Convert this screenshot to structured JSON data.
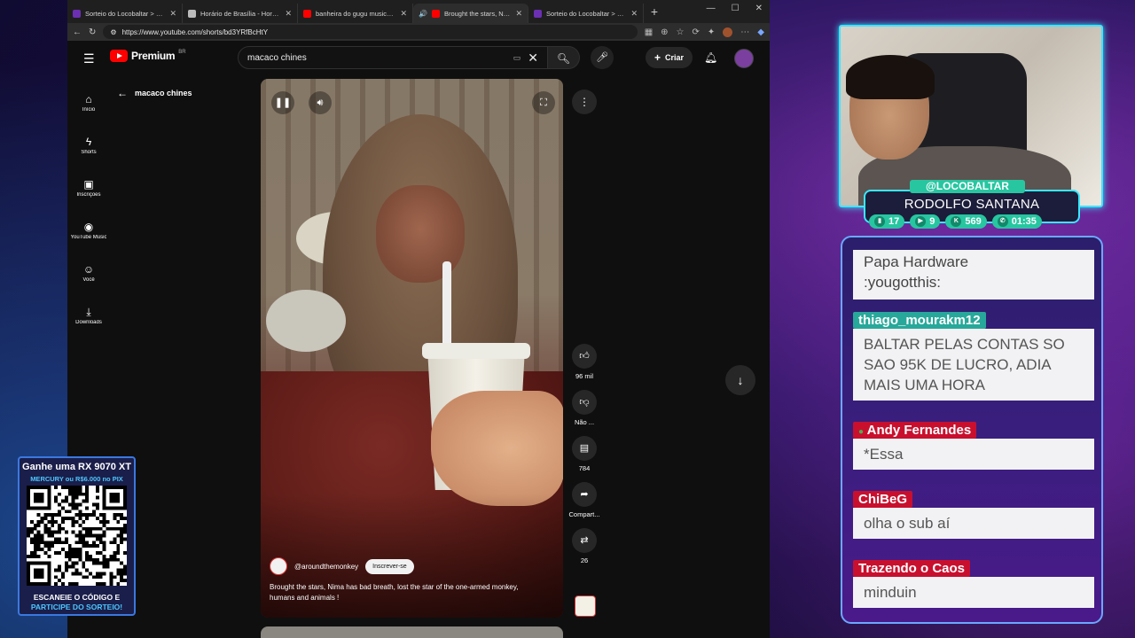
{
  "browser": {
    "tabs": [
      {
        "title": "Sorteio do Locobaltar > Dados",
        "fav_color": "#6b2fb3"
      },
      {
        "title": "Horário de Brasília - Hora Certa",
        "fav_color": "#bbbbbb"
      },
      {
        "title": "banheira do gugu musica - YouTube",
        "fav_color": "#ff0000"
      },
      {
        "title": "Brought the stars, Nima h",
        "fav_color": "#ff0000"
      },
      {
        "title": "Sorteio do Locobaltar > Sorteio",
        "fav_color": "#6b2fb3"
      }
    ],
    "url": "https://www.youtube.com/shorts/bd3YRfBcHtY"
  },
  "youtube": {
    "logo_text": "Premium",
    "logo_region": "BR",
    "search_value": "macaco chines",
    "create_label": "Criar",
    "sidebar": [
      {
        "label": "Início",
        "icon": "home-icon"
      },
      {
        "label": "Shorts",
        "icon": "shorts-icon"
      },
      {
        "label": "Inscrições",
        "icon": "subscriptions-icon"
      },
      {
        "label": "YouTube Music",
        "icon": "music-icon"
      },
      {
        "label": "Você",
        "icon": "user-icon"
      },
      {
        "label": "Downloads",
        "icon": "download-icon"
      }
    ],
    "back_label": "macaco chines",
    "short": {
      "channel_handle": "@aroundthemonkey",
      "subscribe_label": "Inscrever-se",
      "caption": "Brought the stars, Nima has bad breath, lost the star of the one-armed monkey, humans and animals !"
    },
    "actions": {
      "likes": "96 mil",
      "dislike_label": "Não ...",
      "comments": "784",
      "share_label": "Compart...",
      "remix_count": "26"
    }
  },
  "stream": {
    "handle": "@LOCOBALTAR",
    "name": "RODOLFO SANTANA",
    "stats": [
      {
        "icon": "twitch-icon",
        "value": "17"
      },
      {
        "icon": "youtube-icon",
        "value": "9"
      },
      {
        "icon": "kick-icon",
        "value": "569"
      },
      {
        "icon": "whatsapp-icon",
        "value": "01:35"
      }
    ]
  },
  "chat": [
    {
      "user": "",
      "text": "Papa Hardware\n:yougotthis:"
    },
    {
      "user": "thiago_mourakm12",
      "color": "#27a89a",
      "text": "BALTAR PELAS CONTAS SO SAO 95K DE LUCRO, ADIA MAIS UMA HORA"
    },
    {
      "user": "Andy Fernandes",
      "color": "#c8102e",
      "text": "*Essa"
    },
    {
      "user": "ChiBeG",
      "color": "#c8102e",
      "text": "olha o sub aí"
    },
    {
      "user": "Trazendo o Caos",
      "color": "#c8102e",
      "text": "minduin"
    }
  ],
  "promo": {
    "line1": "Ganhe uma RX 9070 XT",
    "line2": "MERCURY ou R$6.000 no PIX",
    "line3": "ESCANEIE O CÓDIGO E",
    "line4": "PARTICIPE DO SORTEIO!"
  }
}
